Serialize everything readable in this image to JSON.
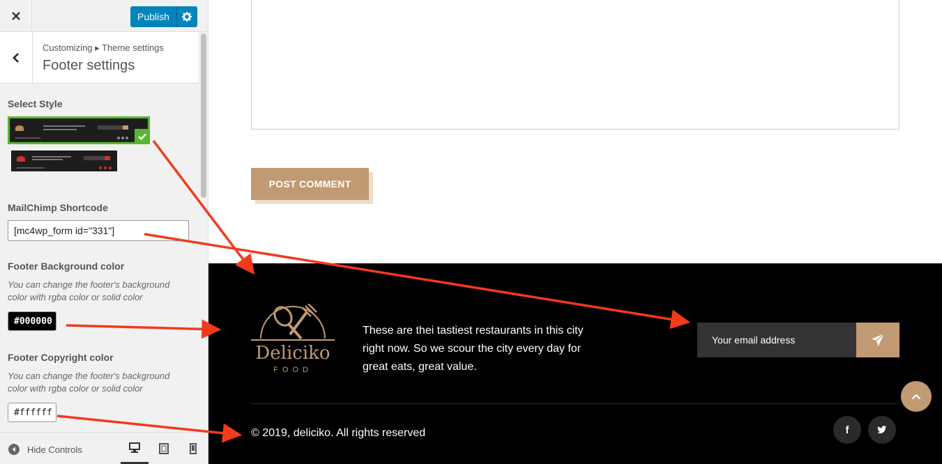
{
  "sidebar": {
    "publish_label": "Publish",
    "breadcrumb": "Customizing ▸ Theme settings",
    "section_title": "Footer settings",
    "select_style_title": "Select Style",
    "mailchimp_title": "MailChimp Shortcode",
    "mailchimp_value": "[mc4wp_form id=\"331\"]",
    "bg_color_title": "Footer Background color",
    "bg_color_desc": "You can change the footer's background color with rgba color or solid color",
    "bg_color_value": "#000000",
    "copyright_color_title": "Footer Copyright color",
    "copyright_color_desc": "You can change the footer's background color with rgba color or solid color",
    "copyright_color_value": "#ffffff",
    "hide_controls_label": "Hide Controls"
  },
  "preview": {
    "post_comment_label": "POST COMMENT",
    "footer": {
      "logo_name": "Deliciko",
      "logo_sub": "FOOD",
      "description": "These are thei tastiest restaurants in this city right now. So we scour the city every day for great eats, great value.",
      "email_placeholder": "Your email address",
      "copyright": "© 2019, deliciko. All rights reserved",
      "social_fb": "f",
      "social_tw": "t"
    }
  },
  "colors": {
    "publish": "#0085ba",
    "accent": "#c19a73",
    "selected_border": "#5bb530",
    "footer_bg": "#000000",
    "annotation_arrow": "#f23a1d"
  },
  "icons": {
    "close": "close-icon",
    "gear": "gear-icon",
    "back": "chevron-left-icon",
    "check": "check-icon",
    "send": "paper-plane-icon",
    "scroll_top": "chevron-up-icon",
    "facebook": "facebook-icon",
    "twitter": "twitter-icon",
    "desktop": "desktop-icon",
    "tablet": "tablet-icon",
    "mobile": "mobile-icon"
  }
}
